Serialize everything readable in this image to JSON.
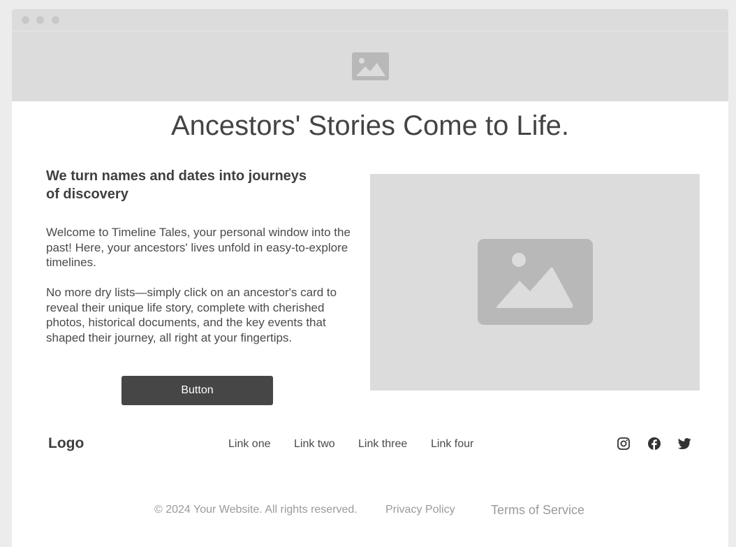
{
  "window": {
    "controls": [
      "close-dot",
      "minimize-dot",
      "maximize-dot"
    ]
  },
  "hero": {
    "banner_icon": "image-icon",
    "title": "Ancestors' Stories Come to Life."
  },
  "main": {
    "subheading": "We turn names and dates into journeys of discovery",
    "paragraph1": "Welcome to Timeline Tales, your personal window into the past! Here, your ancestors' lives unfold in easy-to-explore timelines.",
    "paragraph2": "No more dry lists—simply click on an ancestor's card to reveal their unique life story, complete with cherished photos, historical documents, and the key events that shaped their journey, all right at your fingertips.",
    "button_label": "Button",
    "image_icon": "image-icon"
  },
  "footer": {
    "logo": "Logo",
    "links": [
      "Link one",
      "Link two",
      "Link three",
      "Link four"
    ],
    "social_icons": [
      "instagram-icon",
      "facebook-icon",
      "twitter-icon"
    ],
    "copyright": "© 2024 Your Website. All rights reserved.",
    "privacy": "Privacy Policy",
    "terms": "Terms of Service"
  },
  "colors": {
    "page_background": "#ececec",
    "placeholder_gray": "#dcdcdc",
    "icon_gray": "#b8b8b8",
    "button_dark": "#464646",
    "text_dark": "#444444",
    "text_muted": "#9a9a9a"
  }
}
